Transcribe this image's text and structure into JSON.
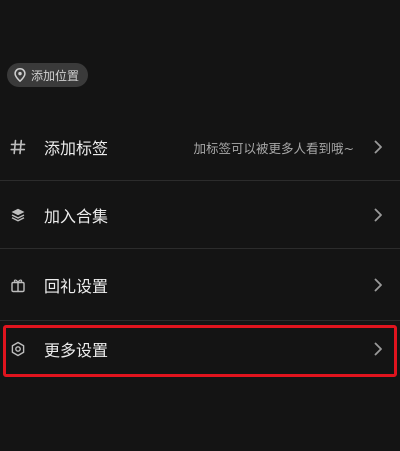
{
  "location": {
    "label": "添加位置",
    "icon": "location-pin-icon"
  },
  "menu": {
    "items": [
      {
        "label": "添加标签",
        "hint": "加标签可以被更多人看到哦~",
        "icon": "hashtag-icon"
      },
      {
        "label": "加入合集",
        "hint": "",
        "icon": "layers-icon"
      },
      {
        "label": "回礼设置",
        "hint": "",
        "icon": "gift-icon"
      },
      {
        "label": "更多设置",
        "hint": "",
        "icon": "settings-icon"
      }
    ]
  },
  "colors": {
    "background": "#141414",
    "highlight": "#e0141e",
    "chip": "#3a3a3a"
  }
}
